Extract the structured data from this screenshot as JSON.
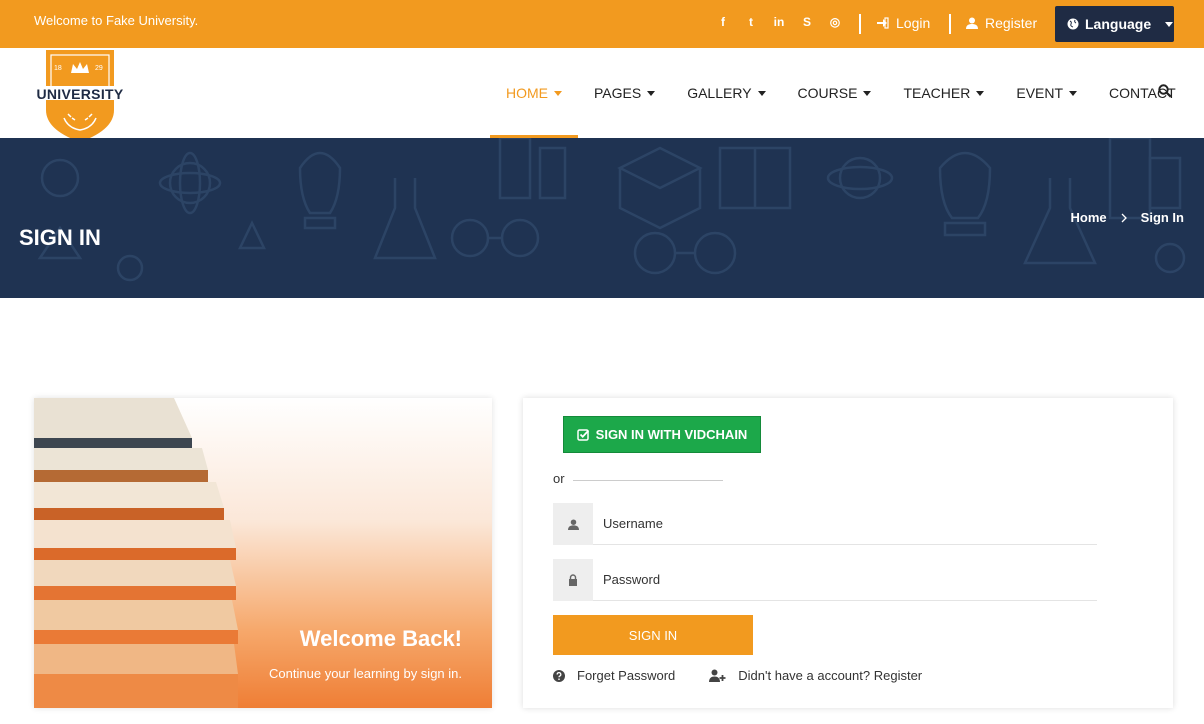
{
  "topbar": {
    "welcome": "Welcome to Fake University.",
    "socials": [
      {
        "icon": "facebook-icon",
        "glyph": "f"
      },
      {
        "icon": "twitter-icon",
        "glyph": "t"
      },
      {
        "icon": "linkedin-icon",
        "glyph": "in"
      },
      {
        "icon": "skype-icon",
        "glyph": "S"
      },
      {
        "icon": "dribbble-icon",
        "glyph": "◎"
      }
    ],
    "login_label": "Login",
    "register_label": "Register",
    "language_label": "Language"
  },
  "logo": {
    "text": "UNIVERSITY",
    "year_left": "18",
    "year_right": "29"
  },
  "nav": {
    "items": [
      {
        "label": "HOME",
        "active": true,
        "dropdown": true
      },
      {
        "label": "PAGES",
        "active": false,
        "dropdown": true
      },
      {
        "label": "GALLERY",
        "active": false,
        "dropdown": true
      },
      {
        "label": "COURSE",
        "active": false,
        "dropdown": true
      },
      {
        "label": "TEACHER",
        "active": false,
        "dropdown": true
      },
      {
        "label": "EVENT",
        "active": false,
        "dropdown": true
      },
      {
        "label": "CONTACT",
        "active": false,
        "dropdown": false
      }
    ]
  },
  "banner": {
    "title": "SIGN IN",
    "breadcrumb": [
      "Home",
      "Sign In"
    ]
  },
  "welcome_panel": {
    "title": "Welcome Back!",
    "subtitle": "Continue your learning by sign in."
  },
  "form": {
    "vidchain_label": "SIGN IN WITH VIDCHAIN",
    "or_label": "or",
    "username_placeholder": "Username",
    "password_placeholder": "Password",
    "signin_label": "SIGN IN",
    "forget_label": "Forget Password",
    "register_label": "Didn't have a account? Register"
  },
  "colors": {
    "accent": "#f29a1f",
    "banner": "#1f3352",
    "language_button": "#1f2b44",
    "vidchain_green": "#1ca84a"
  }
}
